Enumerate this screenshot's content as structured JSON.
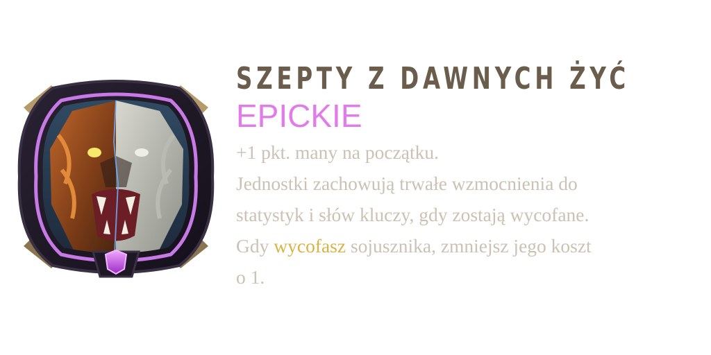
{
  "card": {
    "title": "SZEPTY Z DAWNYCH ŻYĆ",
    "rarity": "EPICKIE",
    "rarity_color": "#e27be9",
    "title_color": "#6b5d4c",
    "text_color": "#cbc1b4",
    "keyword_color": "#d9b343",
    "emblem": {
      "icon": "split-lion-face-icon",
      "gem": "purple-gem-icon",
      "frame_color": "#c77ae6"
    },
    "description": {
      "line1": "+1 pkt. many na początku.",
      "line2": "Jednostki zachowują trwałe wzmocnienia do",
      "line3": "statystyk i słów kluczy, gdy zostają wycofane.",
      "line4_before": "Gdy ",
      "line4_keyword": "wycofasz",
      "line4_after": " sojusznika, zmniejsz jego koszt",
      "line5": "o 1."
    }
  }
}
